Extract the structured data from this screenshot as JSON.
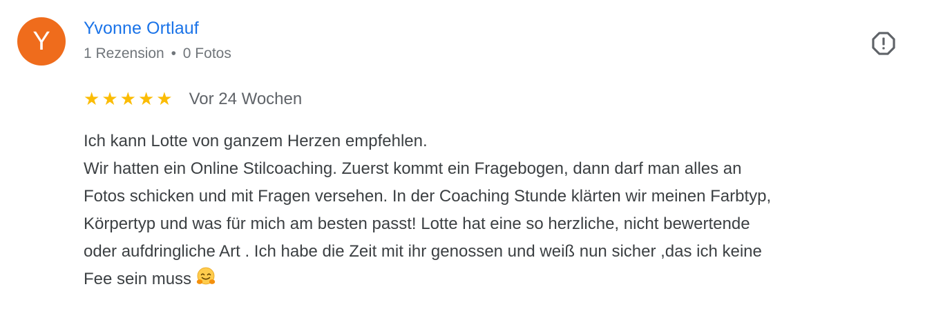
{
  "colors": {
    "avatar_bg": "#ef6c1c",
    "name_link": "#1a73e8",
    "star": "#fbbc04",
    "meta_text": "#70757a",
    "body_text": "#3c4043",
    "report_icon": "#5f6368"
  },
  "reviewer": {
    "avatar_letter": "Y",
    "name": "Yvonne Ortlauf",
    "review_count": "1 Rezension",
    "separator": "•",
    "photo_count": "0 Fotos"
  },
  "report": {
    "icon": "report-flag-octagon-exclamation-icon"
  },
  "rating": {
    "value": 5,
    "max": 5,
    "star_glyph": "★",
    "date": "Vor 24 Wochen"
  },
  "review": {
    "text": "Ich kann Lotte von ganzem Herzen empfehlen.\nWir hatten ein Online Stilcoaching. Zuerst kommt ein Fragebogen, dann darf man alles an\nFotos schicken und mit Fragen versehen. In der Coaching Stunde klärten wir meinen Farbtyp,\nKörpertyp und was für mich am besten passt! Lotte hat eine so herzliche, nicht bewertende\noder aufdringliche Art . Ich habe die Zeit mit ihr genossen und weiß nun sicher ,das ich keine\nFee sein muss",
    "trailing_emoji_icon": "hugging-face-emoji-icon"
  }
}
